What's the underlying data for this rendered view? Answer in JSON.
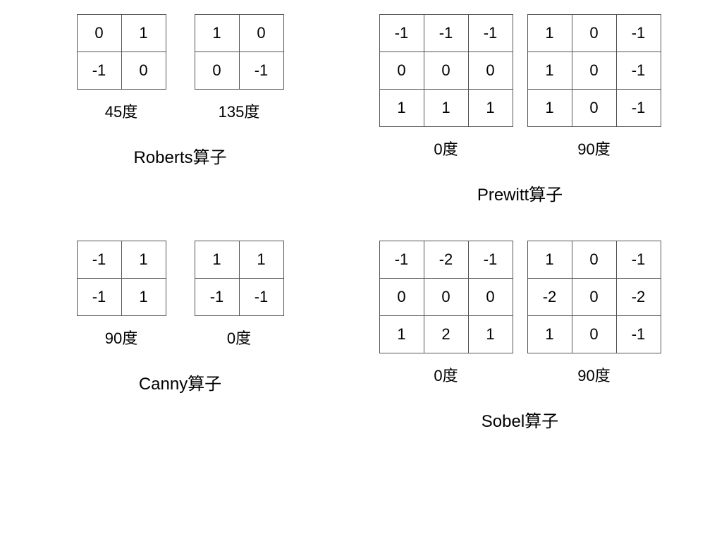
{
  "groups": {
    "roberts": {
      "name": "Roberts算子",
      "k0_angle": "45度",
      "k0": [
        [
          "0",
          "1"
        ],
        [
          "-1",
          "0"
        ]
      ],
      "k1_angle": "135度",
      "k1": [
        [
          "1",
          "0"
        ],
        [
          "0",
          "-1"
        ]
      ]
    },
    "prewitt": {
      "name": "Prewitt算子",
      "k0_angle": "0度",
      "k0": [
        [
          "-1",
          "-1",
          "-1"
        ],
        [
          "0",
          "0",
          "0"
        ],
        [
          "1",
          "1",
          "1"
        ]
      ],
      "k1_angle": "90度",
      "k1": [
        [
          "1",
          "0",
          "-1"
        ],
        [
          "1",
          "0",
          "-1"
        ],
        [
          "1",
          "0",
          "-1"
        ]
      ]
    },
    "canny": {
      "name": "Canny算子",
      "k0_angle": "90度",
      "k0": [
        [
          "-1",
          "1"
        ],
        [
          "-1",
          "1"
        ]
      ],
      "k1_angle": "0度",
      "k1": [
        [
          "1",
          "1"
        ],
        [
          "-1",
          "-1"
        ]
      ]
    },
    "sobel": {
      "name": "Sobel算子",
      "k0_angle": "0度",
      "k0": [
        [
          "-1",
          "-2",
          "-1"
        ],
        [
          "0",
          "0",
          "0"
        ],
        [
          "1",
          "2",
          "1"
        ]
      ],
      "k1_angle": "90度",
      "k1": [
        [
          "1",
          "0",
          "-1"
        ],
        [
          "-2",
          "0",
          "-2"
        ],
        [
          "1",
          "0",
          "-1"
        ]
      ]
    }
  }
}
